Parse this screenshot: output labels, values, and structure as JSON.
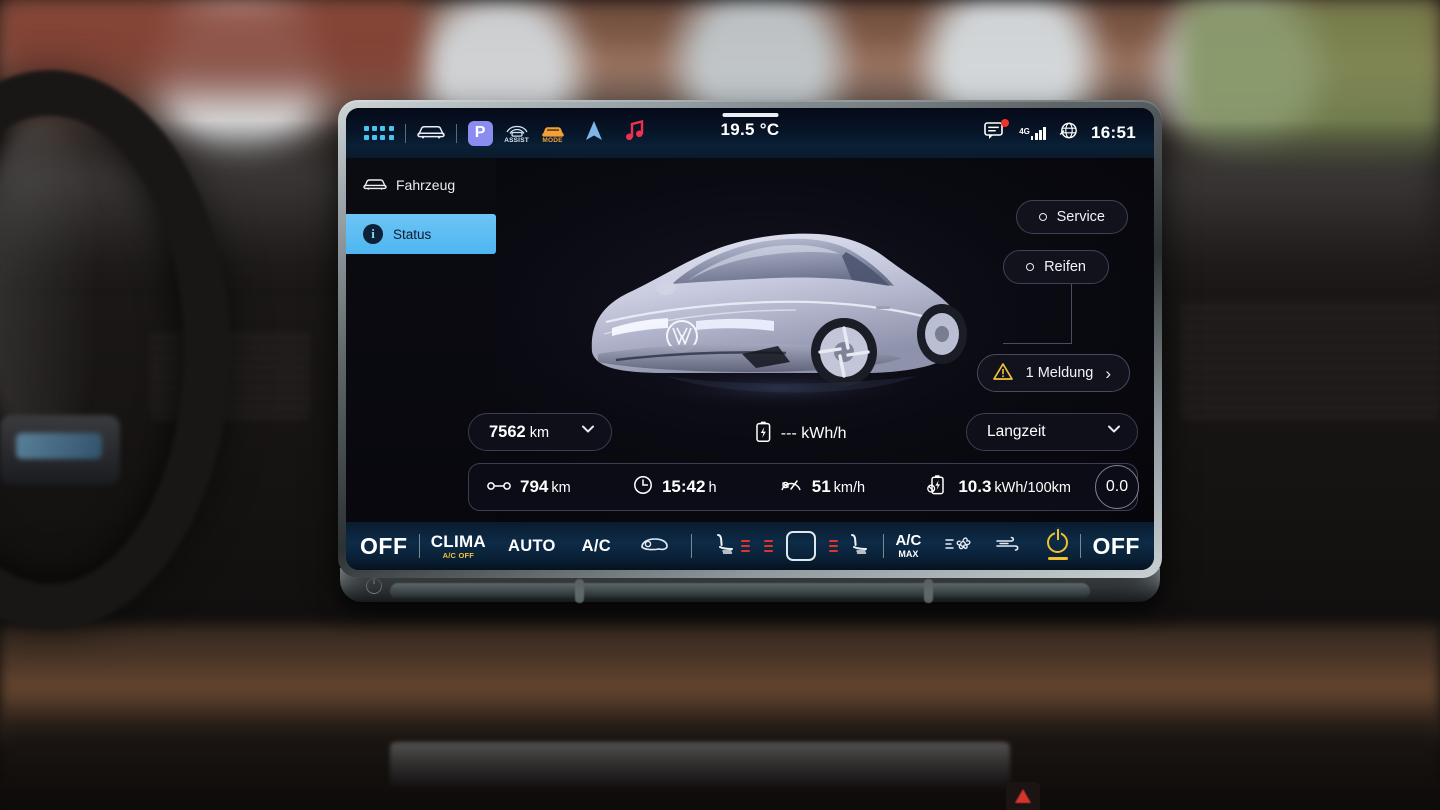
{
  "statusbar": {
    "apps_icon": "app-grid-icon",
    "vehicle_icon": "car-icon",
    "park_label": "P",
    "assist_label": "ASSIST",
    "mode_label": "MODE",
    "nav_icon": "navigation-arrow-icon",
    "media_icon": "music-note-icon",
    "temperature": "19.5 °C",
    "message_icon": "message-bubble-icon",
    "network_generation": "4G",
    "signal_icon": "signal-bars-icon",
    "globe_icon": "globe-icon",
    "clock": "16:51"
  },
  "sidebar": {
    "title": "Fahrzeug",
    "title_icon": "car-icon",
    "items": [
      {
        "label": "Status",
        "icon": "info-icon",
        "selected": true
      }
    ]
  },
  "main": {
    "vehicle_image": "vw-id7-sedan-render",
    "buttons": [
      {
        "id": "service",
        "label": "Service",
        "icon": "circle-icon"
      },
      {
        "id": "reifen",
        "label": "Reifen",
        "icon": "circle-icon"
      }
    ],
    "message_button": {
      "label": "1 Meldung",
      "icon": "warning-triangle-icon",
      "chevron": "chevron-right-icon"
    },
    "odometer": {
      "value": "7562",
      "unit": "km",
      "chevron": "chevron-down-icon"
    },
    "charging": {
      "icon": "battery-charging-icon",
      "value": "---",
      "unit": "kWh/h"
    },
    "period": {
      "value": "Langzeit",
      "chevron": "chevron-down-icon"
    },
    "stats": [
      {
        "icon": "distance-icon",
        "value": "794",
        "unit": "km"
      },
      {
        "icon": "clock-icon",
        "value": "15:42",
        "unit": "h"
      },
      {
        "icon": "speedometer-icon",
        "value": "51",
        "unit": "km/h"
      },
      {
        "icon": "consumption-icon",
        "value": "10.3",
        "unit": "kWh/100km"
      }
    ],
    "badge": "0.0"
  },
  "climate": {
    "left_off": "OFF",
    "clima_title": "CLIMA",
    "clima_sub": "A/C OFF",
    "auto": "AUTO",
    "ac": "A/C",
    "recirc_icon": "recirculation-icon",
    "seat_left_icon": "heated-seat-icon",
    "home_icon": "home-square-icon",
    "seat_right_icon": "heated-seat-icon",
    "ac_max_title": "A/C",
    "ac_max_sub": "MAX",
    "fan_icon": "fan-icon",
    "airflow_icon": "airflow-icon",
    "power_icon": "power-icon",
    "right_off": "OFF"
  },
  "colors": {
    "accent_blue": "#4db6f0",
    "warning_yellow": "#f2c438",
    "alert_red": "#e0332c",
    "park_purple": "#8b8cf0",
    "mode_orange": "#f2a03c"
  }
}
